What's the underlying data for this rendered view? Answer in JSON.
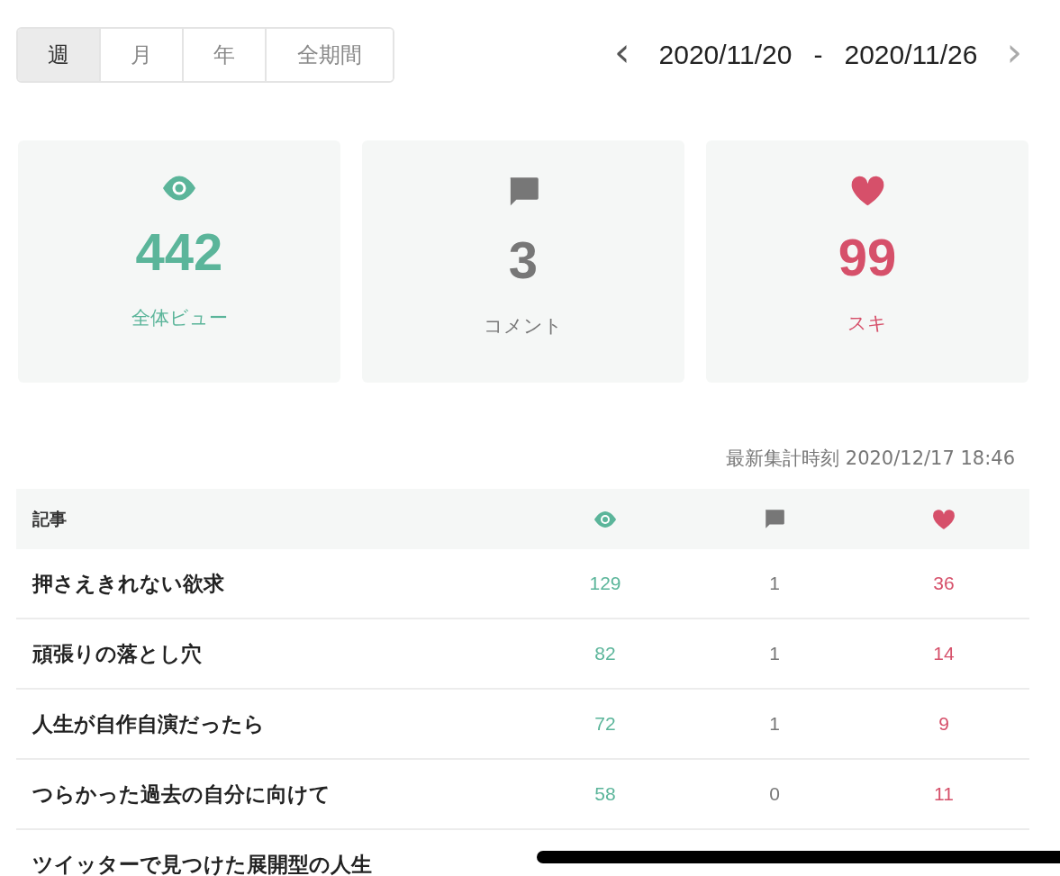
{
  "period_tabs": [
    {
      "label": "週",
      "selected": true
    },
    {
      "label": "月",
      "selected": false
    },
    {
      "label": "年",
      "selected": false
    },
    {
      "label": "全期間",
      "selected": false
    }
  ],
  "date_range": {
    "prev": "‹",
    "start": "2020/11/20",
    "separator": "-",
    "end": "2020/11/26",
    "next": "›"
  },
  "stats": [
    {
      "kind": "views",
      "value": "442",
      "label": "全体ビュー"
    },
    {
      "kind": "comments",
      "value": "3",
      "label": "コメント"
    },
    {
      "kind": "likes",
      "value": "99",
      "label": "スキ"
    }
  ],
  "updated_at": "最新集計時刻 2020/12/17 18:46",
  "table": {
    "columns": [
      {
        "kind": "title",
        "label": "記事"
      },
      {
        "kind": "views"
      },
      {
        "kind": "comments"
      },
      {
        "kind": "likes"
      }
    ],
    "rows": [
      {
        "title": "押さえきれない欲求",
        "views": "129",
        "comments": "1",
        "likes": "36"
      },
      {
        "title": "頑張りの落とし穴",
        "views": "82",
        "comments": "1",
        "likes": "14"
      },
      {
        "title": "人生が自作自演だったら",
        "views": "72",
        "comments": "1",
        "likes": "9"
      },
      {
        "title": "つらかった過去の自分に向けて",
        "views": "58",
        "comments": "0",
        "likes": "11"
      },
      {
        "title": "ツイッターで見つけた展開型の人生"
      }
    ]
  }
}
